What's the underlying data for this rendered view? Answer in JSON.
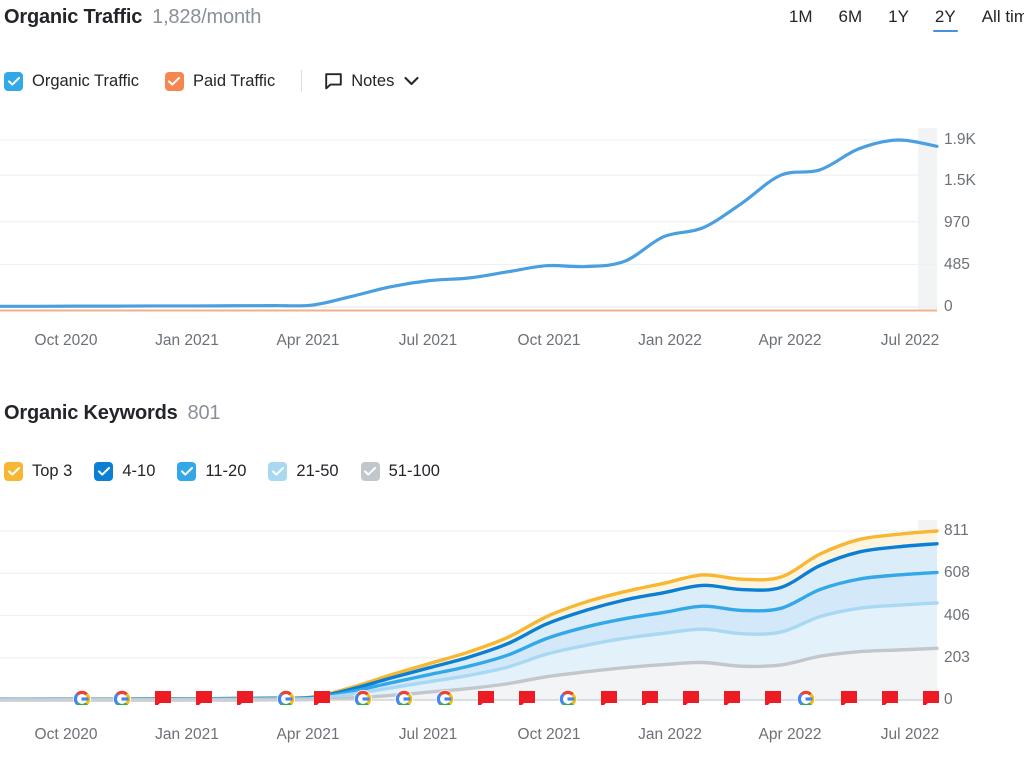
{
  "traffic_section": {
    "title": "Organic Traffic",
    "metric": "1,828/month",
    "ranges": [
      {
        "label": "1M",
        "active": false
      },
      {
        "label": "6M",
        "active": false
      },
      {
        "label": "1Y",
        "active": false
      },
      {
        "label": "2Y",
        "active": true
      },
      {
        "label": "All tim",
        "active": false
      }
    ],
    "legend": [
      {
        "label": "Organic Traffic",
        "color": "#33a8e8",
        "checked": true
      },
      {
        "label": "Paid Traffic",
        "color": "#f5864f",
        "checked": true
      }
    ],
    "notes_label": "Notes"
  },
  "keywords_section": {
    "title": "Organic Keywords",
    "metric": "801",
    "legend": [
      {
        "label": "Top 3",
        "color": "#f7b733",
        "checked": true
      },
      {
        "label": "4-10",
        "color": "#0b7fd4",
        "checked": true
      },
      {
        "label": "11-20",
        "color": "#33a8e8",
        "checked": true
      },
      {
        "label": "21-50",
        "color": "#a9d8f2",
        "checked": true
      },
      {
        "label": "51-100",
        "color": "#c2c7cc",
        "checked": true
      }
    ]
  },
  "chart_data": [
    {
      "type": "line",
      "title": "Organic Traffic",
      "xlabel": "",
      "ylabel": "",
      "ylim": [
        0,
        1900
      ],
      "ytick_labels": [
        "1.9K",
        "1.5K",
        "970",
        "485",
        "0"
      ],
      "ytick_values": [
        1900,
        1500,
        970,
        485,
        0
      ],
      "xtick_labels": [
        "Oct 2020",
        "Jan 2021",
        "Apr 2021",
        "Jul 2021",
        "Oct 2021",
        "Jan 2022",
        "Apr 2022",
        "Jul 2022"
      ],
      "grid": true,
      "legend_position": "top-left",
      "x": [
        "Aug 2020",
        "Sep 2020",
        "Oct 2020",
        "Nov 2020",
        "Dec 2020",
        "Jan 2021",
        "Feb 2021",
        "Mar 2021",
        "Apr 2021",
        "May 2021",
        "Jun 2021",
        "Jul 2021",
        "Aug 2021",
        "Sep 2021",
        "Oct 2021",
        "Nov 2021",
        "Dec 2021",
        "Jan 2022",
        "Feb 2022",
        "Mar 2022",
        "Apr 2022",
        "May 2022",
        "Jun 2022",
        "Jul 2022",
        "Aug 2022"
      ],
      "series": [
        {
          "name": "Organic Traffic",
          "color": "#4a9fe0",
          "values": [
            8,
            8,
            10,
            10,
            12,
            12,
            14,
            16,
            22,
            120,
            230,
            300,
            330,
            400,
            470,
            460,
            520,
            800,
            900,
            1180,
            1500,
            1560,
            1800,
            1900,
            1828
          ]
        },
        {
          "name": "Paid Traffic",
          "color": "#f0b089",
          "values": [
            0,
            0,
            0,
            0,
            0,
            0,
            0,
            0,
            0,
            0,
            0,
            0,
            0,
            0,
            0,
            0,
            0,
            0,
            0,
            0,
            0,
            0,
            0,
            0,
            0
          ]
        }
      ]
    },
    {
      "type": "area",
      "title": "Organic Keywords",
      "xlabel": "",
      "ylabel": "",
      "ylim": [
        0,
        811
      ],
      "ytick_labels": [
        "811",
        "608",
        "406",
        "203",
        "0"
      ],
      "ytick_values": [
        811,
        608,
        406,
        203,
        0
      ],
      "xtick_labels": [
        "Oct 2020",
        "Jan 2021",
        "Apr 2021",
        "Jul 2021",
        "Oct 2021",
        "Jan 2022",
        "Apr 2022",
        "Jul 2022"
      ],
      "grid": true,
      "legend_position": "top-left",
      "x": [
        "Aug 2020",
        "Sep 2020",
        "Oct 2020",
        "Nov 2020",
        "Dec 2020",
        "Jan 2021",
        "Feb 2021",
        "Mar 2021",
        "Apr 2021",
        "May 2021",
        "Jun 2021",
        "Jul 2021",
        "Aug 2021",
        "Sep 2021",
        "Oct 2021",
        "Nov 2021",
        "Dec 2021",
        "Jan 2022",
        "Feb 2022",
        "Mar 2022",
        "Apr 2022",
        "May 2022",
        "Jun 2022",
        "Jul 2022",
        "Aug 2022"
      ],
      "series": [
        {
          "name": "Top 3",
          "color": "#f7b733",
          "values": [
            4,
            4,
            5,
            5,
            6,
            6,
            8,
            10,
            14,
            60,
            120,
            175,
            230,
            300,
            400,
            470,
            520,
            560,
            600,
            580,
            590,
            700,
            770,
            795,
            811
          ]
        },
        {
          "name": "4-10",
          "color": "#0b7fd4",
          "values": [
            3,
            3,
            4,
            4,
            5,
            5,
            7,
            8,
            12,
            52,
            105,
            155,
            205,
            270,
            365,
            430,
            480,
            515,
            550,
            530,
            540,
            645,
            710,
            735,
            750
          ]
        },
        {
          "name": "11-20",
          "color": "#33a8e8",
          "values": [
            2,
            2,
            3,
            3,
            4,
            4,
            5,
            6,
            9,
            40,
            82,
            122,
            162,
            215,
            295,
            350,
            390,
            420,
            450,
            430,
            440,
            530,
            580,
            600,
            612
          ]
        },
        {
          "name": "21-50",
          "color": "#a9d8f2",
          "values": [
            1,
            1,
            2,
            2,
            2,
            3,
            3,
            4,
            6,
            28,
            58,
            88,
            118,
            158,
            220,
            262,
            296,
            320,
            340,
            318,
            326,
            400,
            440,
            455,
            466
          ]
        },
        {
          "name": "51-100",
          "color": "#c2c7cc",
          "values": [
            0,
            0,
            0,
            0,
            0,
            0,
            0,
            1,
            2,
            10,
            22,
            38,
            55,
            78,
            112,
            135,
            155,
            170,
            180,
            162,
            168,
            210,
            232,
            240,
            248
          ]
        }
      ],
      "markers": [
        {
          "x": 82,
          "type": "google"
        },
        {
          "x": 122,
          "type": "google"
        },
        {
          "x": 163,
          "type": "note"
        },
        {
          "x": 204,
          "type": "note"
        },
        {
          "x": 245,
          "type": "note"
        },
        {
          "x": 286,
          "type": "google"
        },
        {
          "x": 322,
          "type": "note"
        },
        {
          "x": 363,
          "type": "google"
        },
        {
          "x": 404,
          "type": "google"
        },
        {
          "x": 445,
          "type": "google"
        },
        {
          "x": 486,
          "type": "note"
        },
        {
          "x": 527,
          "type": "note"
        },
        {
          "x": 568,
          "type": "google"
        },
        {
          "x": 609,
          "type": "note"
        },
        {
          "x": 650,
          "type": "note"
        },
        {
          "x": 691,
          "type": "note"
        },
        {
          "x": 732,
          "type": "note"
        },
        {
          "x": 773,
          "type": "note"
        },
        {
          "x": 806,
          "type": "google"
        },
        {
          "x": 849,
          "type": "note"
        },
        {
          "x": 890,
          "type": "note"
        },
        {
          "x": 931,
          "type": "note"
        }
      ]
    }
  ]
}
